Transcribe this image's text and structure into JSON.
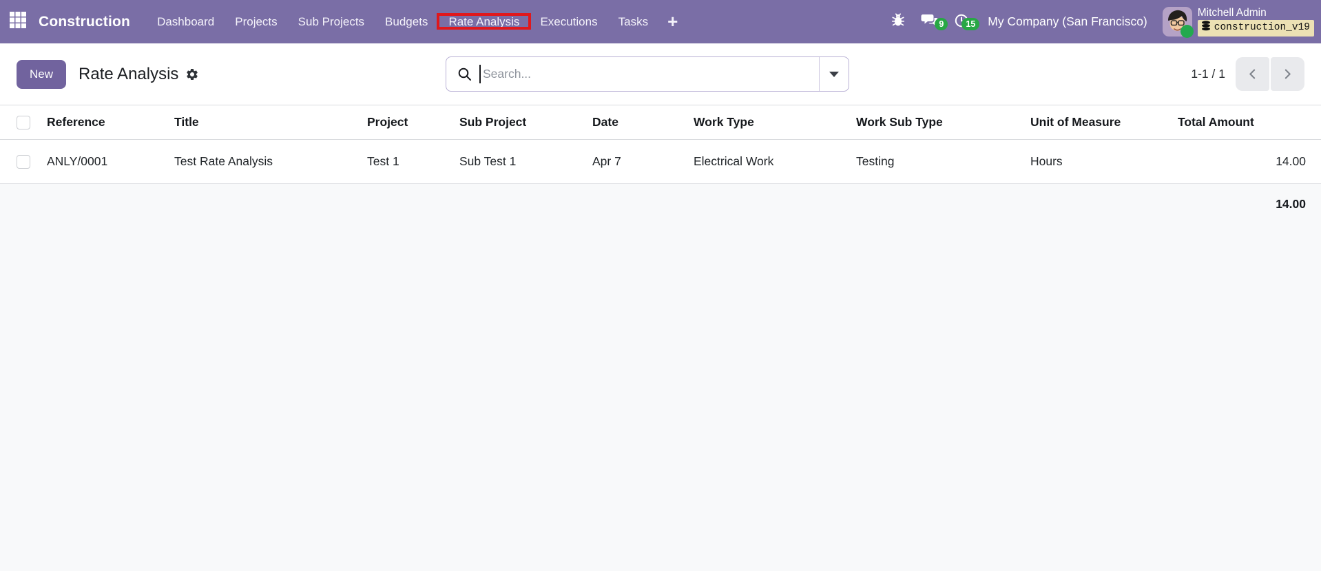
{
  "nav": {
    "app_name": "Construction",
    "items": [
      {
        "label": "Dashboard"
      },
      {
        "label": "Projects"
      },
      {
        "label": "Sub Projects"
      },
      {
        "label": "Budgets"
      },
      {
        "label": "Rate Analysis",
        "annotated": true
      },
      {
        "label": "Executions"
      },
      {
        "label": "Tasks"
      }
    ],
    "plus_label": "+",
    "systray": {
      "messages_count": "9",
      "activities_count": "15",
      "company": "My Company (San Francisco)",
      "user_name": "Mitchell Admin",
      "database": "construction_v19"
    }
  },
  "control_panel": {
    "new_button": "New",
    "title": "Rate Analysis",
    "search_placeholder": "Search...",
    "pager_range": "1-1 / 1"
  },
  "table": {
    "columns": [
      "Reference",
      "Title",
      "Project",
      "Sub Project",
      "Date",
      "Work Type",
      "Work Sub Type",
      "Unit of Measure",
      "Total Amount"
    ],
    "rows": [
      {
        "reference": "ANLY/0001",
        "title": "Test Rate Analysis",
        "project": "Test 1",
        "sub_project": "Sub Test 1",
        "date": "Apr 7",
        "work_type": "Electrical Work",
        "work_sub_type": "Testing",
        "unit_of_measure": "Hours",
        "total_amount": "14.00"
      }
    ],
    "footer_total": "14.00"
  },
  "colors": {
    "navbar_bg": "#7a6ea6",
    "primary_button": "#71639e",
    "badge_green": "#28a745",
    "annotation_red": "#e0181c",
    "db_badge_bg": "#ece1b4",
    "footer_bg": "#f8f9fa"
  }
}
